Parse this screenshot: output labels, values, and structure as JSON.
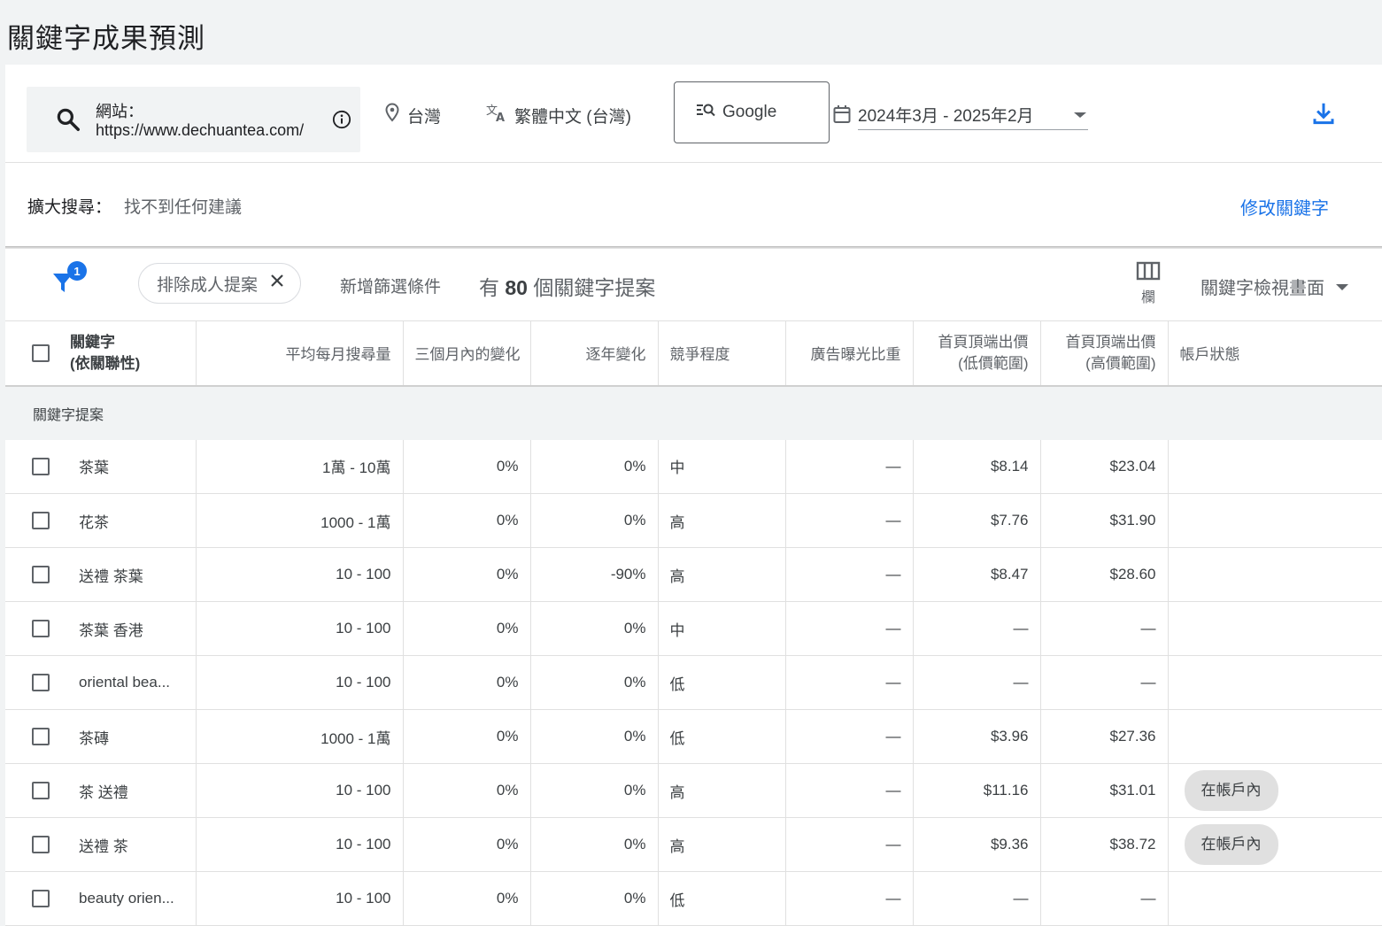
{
  "page_title": "關鍵字成果預測",
  "topbar": {
    "site_label": "網站：",
    "site_url": "https://www.dechuantea.com/",
    "location": "台灣",
    "language": "繁體中文 (台灣)",
    "network": "Google",
    "date_range": "2024年3月 - 2025年2月"
  },
  "expand": {
    "label": "擴大搜尋：",
    "value": "找不到任何建議",
    "modify_link": "修改關鍵字"
  },
  "filters": {
    "badge_count": "1",
    "chip_label": "排除成人提案",
    "add_filter": "新增篩選條件",
    "count_prefix": "有",
    "count_value": "80",
    "count_suffix": "個關鍵字提案",
    "columns_label": "欄",
    "view_label": "關鍵字檢視畫面"
  },
  "table": {
    "headers": {
      "keyword_line1": "關鍵字",
      "keyword_line2": "(依關聯性)",
      "avg_monthly": "平均每月搜尋量",
      "three_month": "三個月內的變化",
      "yoy": "逐年變化",
      "competition": "競爭程度",
      "impression_share": "廣告曝光比重",
      "bid_low_line1": "首頁頂端出價",
      "bid_low_line2": "(低價範圍)",
      "bid_high_line1": "首頁頂端出價",
      "bid_high_line2": "(高價範圍)",
      "account_status": "帳戶狀態"
    },
    "section_label": "關鍵字提案",
    "rows": [
      {
        "keyword": "茶葉",
        "avg": "1萬 - 10萬",
        "three": "0%",
        "yoy": "0%",
        "comp": "中",
        "share": "—",
        "low": "$8.14",
        "high": "$23.04",
        "status": ""
      },
      {
        "keyword": "花茶",
        "avg": "1000 - 1萬",
        "three": "0%",
        "yoy": "0%",
        "comp": "高",
        "share": "—",
        "low": "$7.76",
        "high": "$31.90",
        "status": ""
      },
      {
        "keyword": "送禮 茶葉",
        "avg": "10 - 100",
        "three": "0%",
        "yoy": "-90%",
        "comp": "高",
        "share": "—",
        "low": "$8.47",
        "high": "$28.60",
        "status": ""
      },
      {
        "keyword": "茶葉 香港",
        "avg": "10 - 100",
        "three": "0%",
        "yoy": "0%",
        "comp": "中",
        "share": "—",
        "low": "—",
        "high": "—",
        "status": ""
      },
      {
        "keyword": "oriental bea...",
        "avg": "10 - 100",
        "three": "0%",
        "yoy": "0%",
        "comp": "低",
        "share": "—",
        "low": "—",
        "high": "—",
        "status": ""
      },
      {
        "keyword": "茶磚",
        "avg": "1000 - 1萬",
        "three": "0%",
        "yoy": "0%",
        "comp": "低",
        "share": "—",
        "low": "$3.96",
        "high": "$27.36",
        "status": ""
      },
      {
        "keyword": "茶 送禮",
        "avg": "10 - 100",
        "three": "0%",
        "yoy": "0%",
        "comp": "高",
        "share": "—",
        "low": "$11.16",
        "high": "$31.01",
        "status": "在帳戶內"
      },
      {
        "keyword": "送禮 茶",
        "avg": "10 - 100",
        "three": "0%",
        "yoy": "0%",
        "comp": "高",
        "share": "—",
        "low": "$9.36",
        "high": "$38.72",
        "status": "在帳戶內"
      },
      {
        "keyword": "beauty orien...",
        "avg": "10 - 100",
        "three": "0%",
        "yoy": "0%",
        "comp": "低",
        "share": "—",
        "low": "—",
        "high": "—",
        "status": ""
      }
    ]
  },
  "colors": {
    "accent": "#1a73e8",
    "background": "#f1f3f4",
    "pill": "#e0e0e0"
  }
}
